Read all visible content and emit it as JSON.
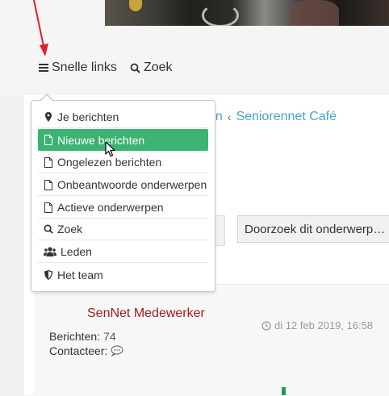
{
  "navbar": {
    "quick_links_label": "Snelle links",
    "search_label": "Zoek"
  },
  "breadcrumb": {
    "partial_text": "en",
    "separator": "‹",
    "forum_label": "Seniorennet Café"
  },
  "dropdown": {
    "items": [
      {
        "label": "Je berichten",
        "icon": "map-marker-icon"
      },
      {
        "label": "Nieuwe berichten",
        "icon": "file-icon",
        "active": true
      },
      {
        "label": "Ongelezen berichten",
        "icon": "file-icon"
      },
      {
        "label": "Onbeantwoorde onderwerpen",
        "icon": "file-icon"
      },
      {
        "label": "Actieve onderwerpen",
        "icon": "file-icon"
      },
      {
        "label": "Zoek",
        "icon": "search-icon"
      },
      {
        "label": "Leden",
        "icon": "users-icon"
      },
      {
        "label": "Het team",
        "icon": "shield-icon"
      }
    ]
  },
  "topic_search": {
    "placeholder": "Doorzoek dit onderwerp…"
  },
  "post": {
    "author": "SenNet Medewerker",
    "date": "di 12 feb 2019, 16:58",
    "posts_label": "Berichten:",
    "posts_count": "74",
    "contact_label": "Contacteer:"
  },
  "colors": {
    "active_item": "#3cb371",
    "link": "#4aa3c9",
    "author": "#a11d1d",
    "arrow": "#e0202a"
  }
}
